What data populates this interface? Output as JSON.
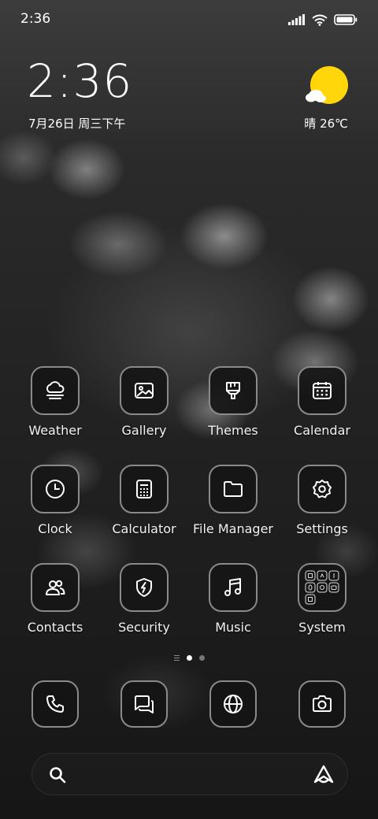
{
  "status_bar": {
    "time": "2:36",
    "icons": [
      "signal-icon",
      "wifi-icon",
      "battery-icon"
    ]
  },
  "clock_widget": {
    "time": "2:36",
    "date": "7月26日 周三下午"
  },
  "weather_widget": {
    "icon": "partly-sunny-icon",
    "text": "晴 26℃",
    "sun_color": "#FFD60A"
  },
  "apps": [
    {
      "label": "Weather",
      "icon": "weather-icon"
    },
    {
      "label": "Gallery",
      "icon": "gallery-icon"
    },
    {
      "label": "Themes",
      "icon": "themes-brush-icon"
    },
    {
      "label": "Calendar",
      "icon": "calendar-icon"
    },
    {
      "label": "Clock",
      "icon": "clock-icon"
    },
    {
      "label": "Calculator",
      "icon": "calculator-icon"
    },
    {
      "label": "File Manager",
      "icon": "folder-icon"
    },
    {
      "label": "Settings",
      "icon": "gear-icon"
    },
    {
      "label": "Contacts",
      "icon": "contacts-icon"
    },
    {
      "label": "Security",
      "icon": "security-shield-icon"
    },
    {
      "label": "Music",
      "icon": "music-note-icon"
    },
    {
      "label": "System",
      "icon": "system-folder-icon"
    }
  ],
  "page_indicator": {
    "pages": 2,
    "current": 1
  },
  "dock": [
    {
      "icon": "phone-icon"
    },
    {
      "icon": "messages-icon"
    },
    {
      "icon": "browser-globe-icon"
    },
    {
      "icon": "camera-icon"
    }
  ],
  "search_bar": {
    "icon": "search-icon",
    "assistant_icon": "assistant-icon"
  }
}
